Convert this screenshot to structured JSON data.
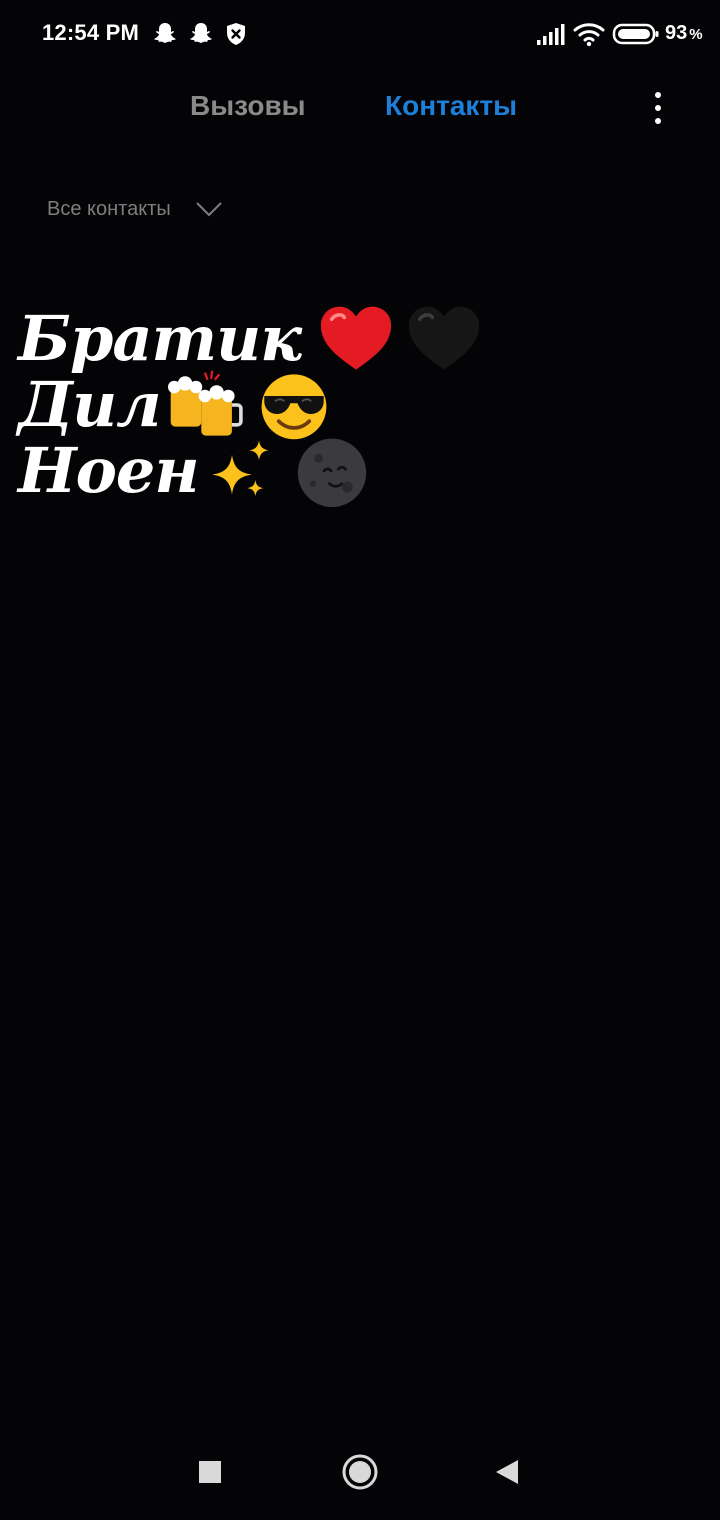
{
  "status_bar": {
    "time": "12:54 PM",
    "notification_icons": [
      "snapchat-icon",
      "snapchat-icon",
      "shield-icon"
    ],
    "system_icons": [
      "signal-icon",
      "wifi-icon",
      "battery-icon"
    ],
    "battery_value": "93",
    "battery_unit": "%"
  },
  "header": {
    "tabs": [
      {
        "label": "Вызовы",
        "active": false
      },
      {
        "label": "Контакты",
        "active": true
      }
    ],
    "menu_icon": "more-vertical-icon"
  },
  "filter": {
    "label": "Все контакты",
    "icon": "chevron-down-icon"
  },
  "contacts": [
    {
      "name": "Братик",
      "emojis": [
        "red-heart-icon",
        "black-heart-icon"
      ]
    },
    {
      "name": "Дил",
      "emojis": [
        "beer-mugs-icon",
        "sunglasses-face-icon"
      ]
    },
    {
      "name": "Ноен",
      "emojis": [
        "sparkles-icon",
        "new-moon-face-icon"
      ]
    }
  ],
  "nav_bar": {
    "buttons": [
      "recents-square-icon",
      "home-circle-icon",
      "back-triangle-icon"
    ]
  },
  "colors": {
    "background": "#040306",
    "active_tab": "#1e7fd9",
    "inactive_tab": "#8a8a8a",
    "filter_text": "#7e7e7e"
  }
}
